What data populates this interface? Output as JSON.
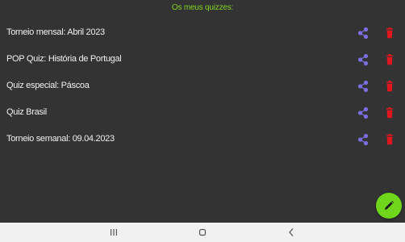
{
  "header": {
    "title": "Os meus quizzes:"
  },
  "quizzes": [
    {
      "title": "Torneio mensal: Abril 2023"
    },
    {
      "title": "POP Quiz: História de Portugal"
    },
    {
      "title": "Quiz especial: Páscoa"
    },
    {
      "title": "Quiz Brasil"
    },
    {
      "title": "Torneio semanal: 09.04.2023"
    }
  ],
  "icons": {
    "share": "share-icon",
    "delete": "trash-icon",
    "fab": "pencil-icon",
    "nav_recents": "recents-icon",
    "nav_home": "home-icon",
    "nav_back": "back-icon"
  },
  "colors": {
    "background": "#333333",
    "header_text": "#7fd321",
    "share_icon": "#7b6fe0",
    "delete_icon": "#e0161e",
    "fab": "#6fd61c"
  }
}
